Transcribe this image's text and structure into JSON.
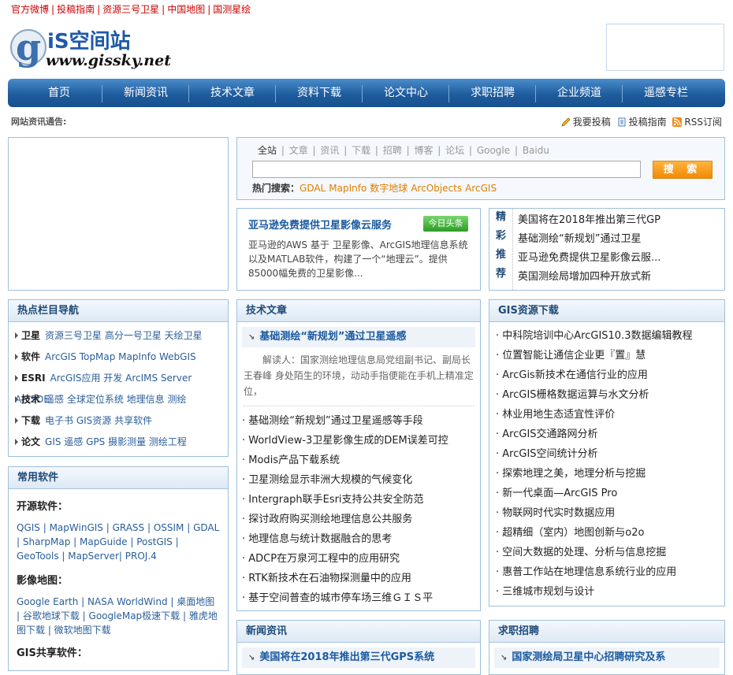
{
  "topbar": {
    "links": [
      "官方微博",
      "投稿指南",
      "资源三号卫星",
      "中国地图",
      "国测星绘"
    ]
  },
  "logo": {
    "brand": "iS空间站",
    "url": "www.gissky.net"
  },
  "nav": {
    "items": [
      "首页",
      "新闻资讯",
      "技术文章",
      "资料下载",
      "论文中心",
      "求职招聘",
      "企业频道",
      "遥感专栏"
    ]
  },
  "notice": {
    "label": "网站资讯通告:"
  },
  "quicklinks": {
    "submit": "我要投稿",
    "guide": "投稿指南",
    "rss": "RSS订阅"
  },
  "search": {
    "tabs": [
      "全站",
      "文章",
      "资讯",
      "下载",
      "招聘",
      "博客",
      "论坛",
      "Google",
      "Baidu"
    ],
    "button": "搜 索",
    "hot_label": "热门搜索：",
    "hot_terms": [
      "GDAL",
      "MapInfo",
      "数字地球",
      "ArcObjects",
      "ArcGIS"
    ]
  },
  "headline": {
    "title": "亚马逊免费提供卫星影像云服务",
    "tag": "今日头条",
    "text": "亚马逊的AWS 基于 卫星影像、ArcGIS地理信息系统以及MATLAB软件，构建了一个“地理云”。提供85000幅免费的卫星影像..."
  },
  "recommend": {
    "label": [
      "精",
      "彩",
      "推",
      "荐"
    ],
    "items": [
      "美国将在2018年推出第三代GP",
      "基础测绘“新规划”通过卫星",
      "亚马逊免费提供卫星影像云服...",
      "英国测绘局增加四种开放式新"
    ]
  },
  "hotnav": {
    "title": "热点栏目导航",
    "rows": [
      {
        "head": "卫星",
        "links": "资源三号卫星 高分一号卫星 天绘卫星"
      },
      {
        "head": "软件",
        "links": "ArcGIS TopMap MapInfo WebGIS"
      },
      {
        "head": "ESRI",
        "links": "ArcGIS应用 开发 ArcIMS Server ArcSDE"
      },
      {
        "head": "技术",
        "links": "遥感 全球定位系统 地理信息 测绘"
      },
      {
        "head": "下载",
        "links": "电子书 GIS资源 共享软件"
      },
      {
        "head": "论文",
        "links": "GIS 遥感 GPS 摄影测量 测绘工程"
      }
    ]
  },
  "software": {
    "title": "常用软件",
    "open_label": "开源软件：",
    "open_links": "QGIS | MapWinGIS | GRASS | OSSIM | GDAL | SharpMap | MapGuide | PostGIS | GeoTools | MapServer| PROJ.4",
    "image_label": "影像地图：",
    "image_links": "Google Earth | NASA WorldWind | 桌面地图 | 谷歌地球下载 | GoogleMap极速下载 | 雅虎地图下载 | 微软地图下载",
    "share_label": "GIS共享软件："
  },
  "tech": {
    "title": "技术文章",
    "feature_title": "基础测绘“新规划”通过卫星遥感",
    "feature_text": "解读人：国家测绘地理信息局党组副书记、副局长 王春峰 身处陌生的环境，动动手指便能在手机上精准定位，",
    "items": [
      "基础测绘“新规划”通过卫星遥感等手段",
      "WorldView-3卫星影像生成的DEM误差可控",
      "Modis产品下载系统",
      "卫星测绘显示非洲大规模的气候变化",
      "Intergraph联手Esri支持公共安全防范",
      "探讨政府购买测绘地理信息公共服务",
      "地理信息与统计数据融合的思考",
      "ADCP在万泉河工程中的应用研究",
      "RTK新技术在石油物探测量中的应用",
      "基于空间普查的城市停车场三维ＧＩＳ平"
    ]
  },
  "gisdl": {
    "title": "GIS资源下载",
    "items": [
      "中科院培训中心ArcGIS10.3数据编辑教程",
      "位置智能让通信企业更『置』慧",
      "ArcGis新技术在通信行业的应用",
      "ArcGIS栅格数据运算与水文分析",
      "林业用地生态适宜性评价",
      "ArcGIS交通路网分析",
      "ArcGIS空间统计分析",
      "探索地理之美，地理分析与挖掘",
      "新一代桌面—ArcGIS Pro",
      "物联网时代实时数据应用",
      "超精细（室内）地图创新与o2o",
      "空间大数据的处理、分析与信息挖掘",
      "惠普工作站在地理信息系统行业的应用",
      "三维城市规划与设计"
    ]
  },
  "news": {
    "title": "新闻资讯",
    "feature_title": "美国将在2018年推出第三代GPS系统"
  },
  "jobs": {
    "title": "求职招聘",
    "feature_title": "国家测绘局卫星中心招聘研究及系"
  }
}
